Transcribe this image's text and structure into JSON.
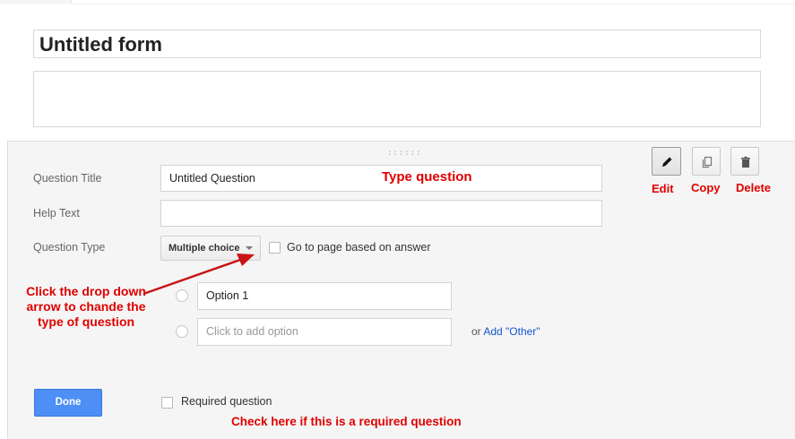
{
  "form": {
    "title": "Untitled form",
    "description": ""
  },
  "question": {
    "title_label": "Question Title",
    "title_value": "Untitled Question",
    "help_label": "Help Text",
    "help_value": "",
    "type_label": "Question Type",
    "type_value": "Multiple choice",
    "goto_label": "Go to page based on answer",
    "options": [
      {
        "value": "Option 1",
        "placeholder": ""
      },
      {
        "value": "",
        "placeholder": "Click to add option"
      }
    ],
    "or_text": "or",
    "add_other": "Add \"Other\"",
    "required_label": "Required question",
    "done_label": "Done",
    "drag_handle": "::::::"
  },
  "toolbar": {
    "icons": [
      "pencil-icon",
      "copy-icon",
      "trash-icon"
    ]
  },
  "annotations": {
    "type_question": "Type question",
    "edit": "Edit",
    "copy": "Copy",
    "delete": "Delete",
    "drop_arrow": "Click the drop down arrow to chande the type of question",
    "required": "Check here if this is a required question"
  },
  "colors": {
    "annotation": "#e00000",
    "done_button": "#4d8ff5",
    "link": "#1155cc"
  }
}
